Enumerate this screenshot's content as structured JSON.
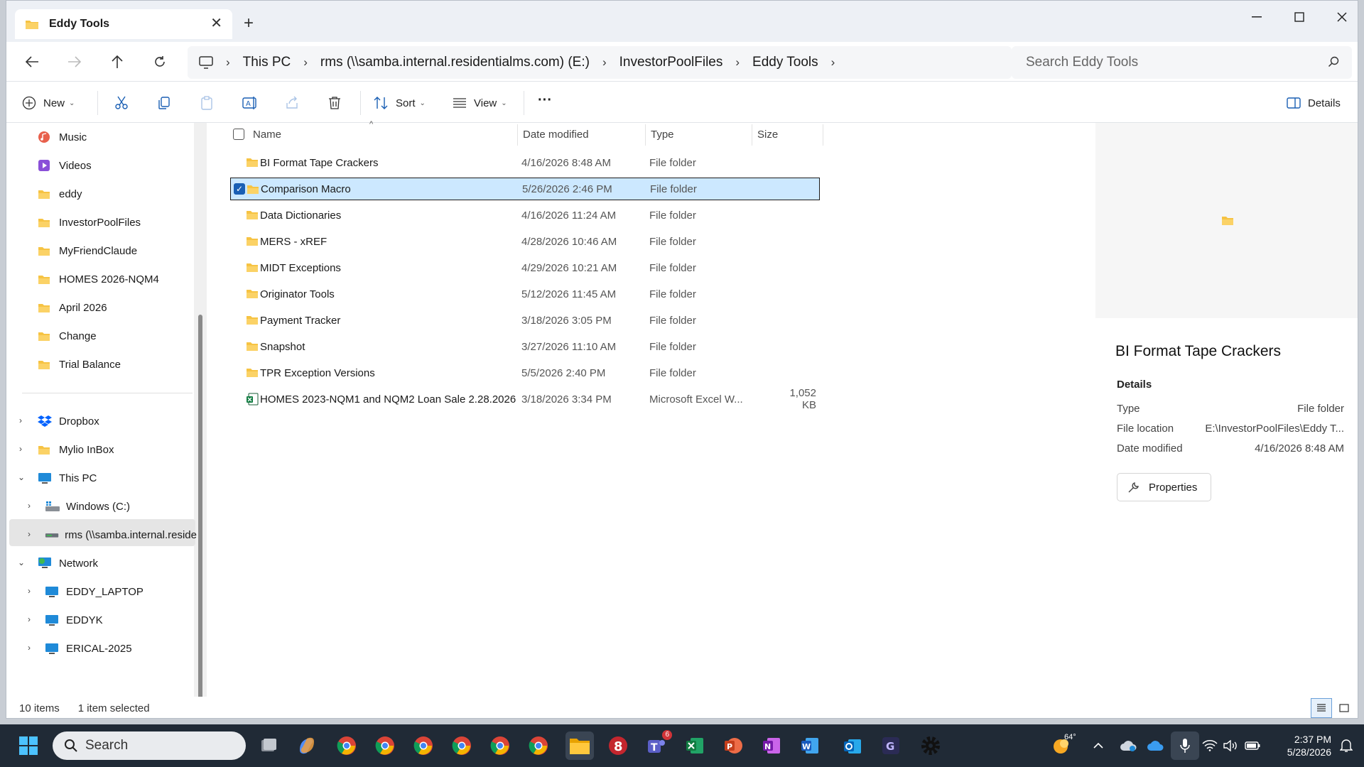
{
  "window": {
    "tab_title": "Eddy Tools",
    "minimize": "—",
    "maximize": "☐",
    "close": "✕"
  },
  "nav": {
    "breadcrumbs": [
      "This PC",
      "rms (\\\\samba.internal.residentialms.com) (E:)",
      "InvestorPoolFiles",
      "Eddy Tools"
    ],
    "search_placeholder": "Search Eddy Tools"
  },
  "toolbar": {
    "new_label": "New",
    "sort_label": "Sort",
    "view_label": "View",
    "more_label": "···",
    "details_label": "Details"
  },
  "sidebar": {
    "quick_access": [
      {
        "label": "Music",
        "icon": "music-icon",
        "pinned": true
      },
      {
        "label": "Videos",
        "icon": "videos-icon",
        "pinned": true
      },
      {
        "label": "eddy",
        "icon": "folder-icon",
        "pinned": true
      },
      {
        "label": "InvestorPoolFiles",
        "icon": "folder-icon",
        "pinned": true
      },
      {
        "label": "MyFriendClaude",
        "icon": "folder-icon",
        "pinned": true
      },
      {
        "label": "HOMES 2026-NQM4",
        "icon": "folder-icon",
        "pinned": true
      },
      {
        "label": "April 2026",
        "icon": "folder-icon",
        "pinned": true
      },
      {
        "label": "Change",
        "icon": "folder-icon",
        "pinned": false
      },
      {
        "label": "Trial Balance",
        "icon": "folder-icon",
        "pinned": false
      }
    ],
    "tree": [
      {
        "label": "Dropbox",
        "icon": "dropbox-icon"
      },
      {
        "label": "Mylio InBox",
        "icon": "folder-icon"
      },
      {
        "label": "This PC",
        "icon": "pc-icon"
      },
      {
        "label": "Windows (C:)",
        "icon": "drive-icon"
      },
      {
        "label": "rms (\\\\samba.internal.reside",
        "icon": "network-drive-icon"
      },
      {
        "label": "Network",
        "icon": "network-icon"
      },
      {
        "label": "EDDY_LAPTOP",
        "icon": "computer-icon"
      },
      {
        "label": "EDDYK",
        "icon": "computer-icon"
      },
      {
        "label": "ERICAL-2025",
        "icon": "computer-icon"
      }
    ]
  },
  "files": {
    "columns": [
      "Name",
      "Date modified",
      "Type",
      "Size"
    ],
    "rows": [
      {
        "name": "BI Format Tape Crackers",
        "date": "4/16/2026 8:48 AM",
        "type": "File folder",
        "size": ""
      },
      {
        "name": "Comparison Macro",
        "date": "5/26/2026 2:46 PM",
        "type": "File folder",
        "size": ""
      },
      {
        "name": "Data Dictionaries",
        "date": "4/16/2026 11:24 AM",
        "type": "File folder",
        "size": ""
      },
      {
        "name": "MERS - xREF",
        "date": "4/28/2026 10:46 AM",
        "type": "File folder",
        "size": ""
      },
      {
        "name": "MIDT Exceptions",
        "date": "4/29/2026 10:21 AM",
        "type": "File folder",
        "size": ""
      },
      {
        "name": "Originator Tools",
        "date": "5/12/2026 11:45 AM",
        "type": "File folder",
        "size": ""
      },
      {
        "name": "Payment Tracker",
        "date": "3/18/2026 3:05 PM",
        "type": "File folder",
        "size": ""
      },
      {
        "name": "Snapshot",
        "date": "3/27/2026 11:10 AM",
        "type": "File folder",
        "size": ""
      },
      {
        "name": "TPR Exception Versions",
        "date": "5/5/2026 2:40 PM",
        "type": "File folder",
        "size": ""
      },
      {
        "name": "HOMES 2023-NQM1 and NQM2 Loan Sale 2.28.2026",
        "date": "3/18/2026 3:34 PM",
        "type": "Microsoft Excel W...",
        "size": "1,052 KB"
      }
    ]
  },
  "details": {
    "title": "BI Format Tape Crackers",
    "section": "Details",
    "props": [
      {
        "label": "Type",
        "value": "File folder"
      },
      {
        "label": "File location",
        "value": "E:\\InvestorPoolFiles\\Eddy T..."
      },
      {
        "label": "Date modified",
        "value": "4/16/2026 8:48 AM"
      }
    ],
    "properties_button": "Properties"
  },
  "status": {
    "item_count": "10 items",
    "selection": "1 item selected"
  },
  "taskbar": {
    "search_label": "Search",
    "teams_badge": "6",
    "weather": "64°",
    "time": "2:37 PM",
    "date": "5/28/2026"
  },
  "colors": {
    "selection": "#cce8ff",
    "folder": "#f6c343",
    "accent": "#1a5fb4",
    "taskbar": "#202a36"
  }
}
